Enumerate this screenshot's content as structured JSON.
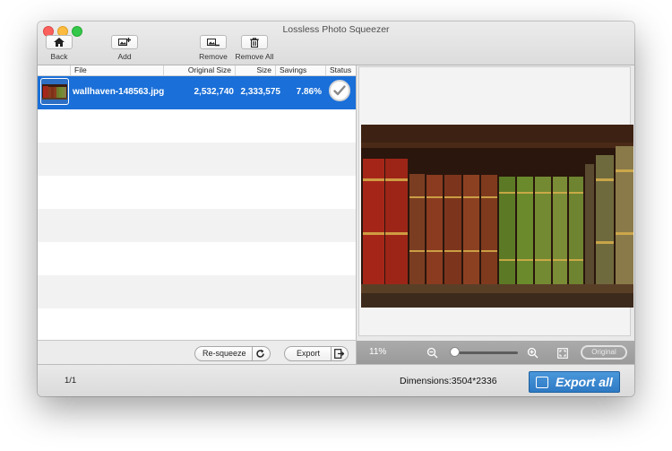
{
  "window": {
    "title": "Lossless Photo Squeezer"
  },
  "toolbar": {
    "back_label": "Back",
    "add_label": "Add",
    "remove_label": "Remove",
    "remove_all_label": "Remove All"
  },
  "table": {
    "columns": [
      "File",
      "Original Size",
      "Size",
      "Savings",
      "Status"
    ],
    "rows": [
      {
        "file": "wallhaven-148563.jpg",
        "original_size": "2,532,740",
        "size": "2,333,575",
        "savings": "7.86%",
        "status": "done"
      }
    ]
  },
  "left_actions": {
    "resqueeze_label": "Re-squeeze",
    "export_label": "Export"
  },
  "preview": {
    "zoom": "11%",
    "zoom_fraction": 0.0,
    "original_label": "Original"
  },
  "footer": {
    "pager": "1/1",
    "dimensions": "Dimensions:3504*2336",
    "export_all_label": "Export all"
  },
  "colors": {
    "selection": "#1a6fd8",
    "export_all": "#3a87cf"
  },
  "icons": [
    "home-icon",
    "add-image-icon",
    "remove-image-icon",
    "trash-icon",
    "refresh-icon",
    "export-icon",
    "zoom-out-icon",
    "zoom-in-icon",
    "fit-screen-icon",
    "checkmark-icon"
  ]
}
